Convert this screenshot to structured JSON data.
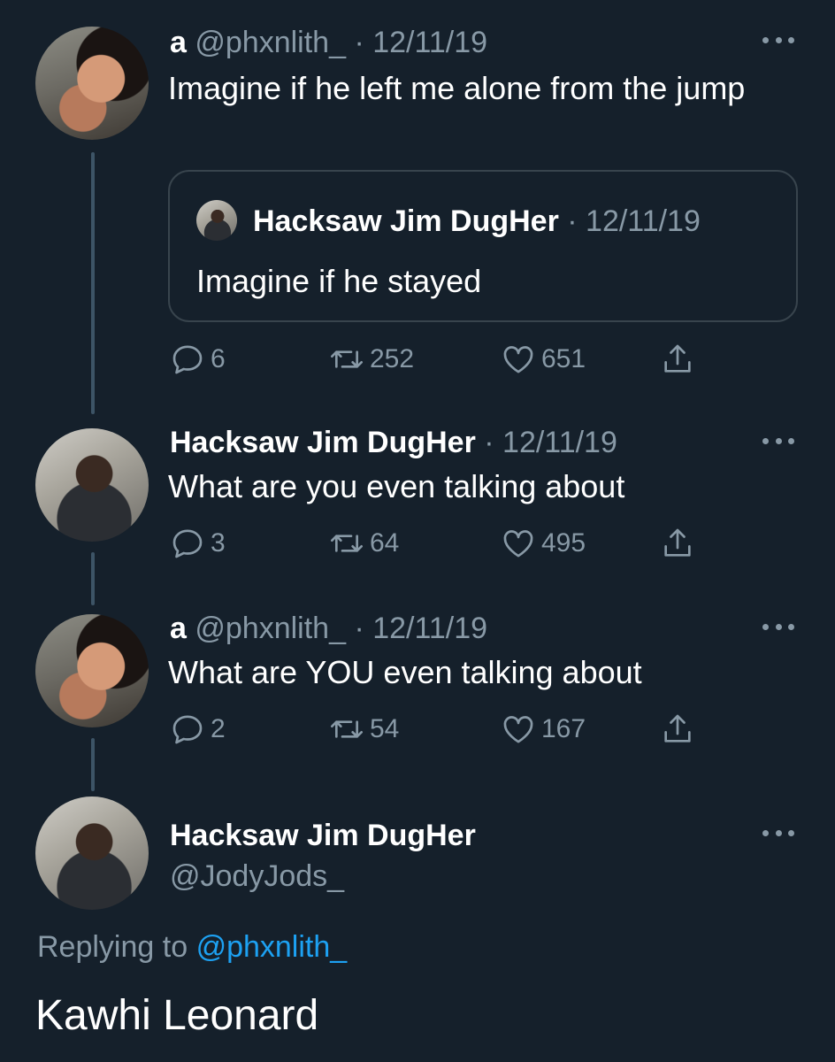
{
  "tweets": [
    {
      "display_name": "a",
      "handle": "@phxnlith_",
      "date": "12/11/19",
      "text": "Imagine if he left me alone from the jump",
      "quoted": {
        "display_name": "Hacksaw Jim DugHer",
        "date": "12/11/19",
        "text": "Imagine if he stayed"
      },
      "stats": {
        "replies": "6",
        "retweets": "252",
        "likes": "651"
      }
    },
    {
      "display_name": "Hacksaw Jim DugHer",
      "date": "12/11/19",
      "text": "What are you even talking about",
      "stats": {
        "replies": "3",
        "retweets": "64",
        "likes": "495"
      }
    },
    {
      "display_name": "a",
      "handle": "@phxnlith_",
      "date": "12/11/19",
      "text": "What are YOU even talking about",
      "stats": {
        "replies": "2",
        "retweets": "54",
        "likes": "167"
      }
    }
  ],
  "focused_tweet": {
    "display_name": "Hacksaw Jim DugHer",
    "handle": "@JodyJods_",
    "replying_prefix": "Replying to",
    "replying_handle": "@phxnlith_",
    "text": "Kawhi Leonard"
  },
  "separator": "·",
  "colors": {
    "background": "#15202b",
    "secondary_text": "#8899a6",
    "link": "#1da1f2",
    "border": "#38444d"
  },
  "icons": [
    "more-icon",
    "reply-icon",
    "retweet-icon",
    "like-icon",
    "share-icon"
  ]
}
